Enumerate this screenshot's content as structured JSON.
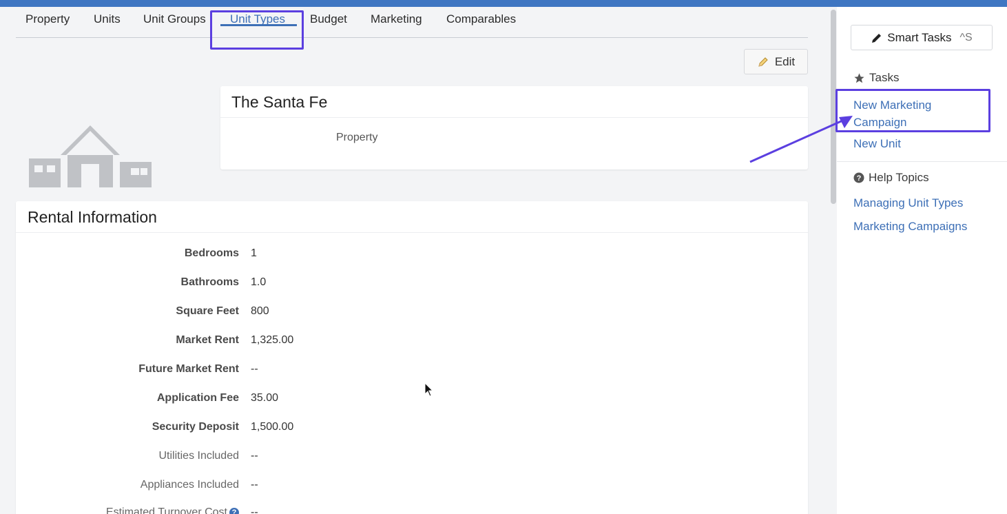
{
  "tabs": [
    {
      "label": "Property"
    },
    {
      "label": "Units"
    },
    {
      "label": "Unit Groups"
    },
    {
      "label": "Unit Types",
      "active": true
    },
    {
      "label": "Budget"
    },
    {
      "label": "Marketing"
    },
    {
      "label": "Comparables"
    }
  ],
  "edit_button": {
    "label": "Edit",
    "icon": "pencil-icon"
  },
  "property_card": {
    "title": "The Santa Fe",
    "property_label": "Property"
  },
  "rental": {
    "title": "Rental Information",
    "rows": [
      {
        "label": "Bedrooms",
        "value": "1"
      },
      {
        "label": "Bathrooms",
        "value": "1.0"
      },
      {
        "label": "Square Feet",
        "value": "800"
      },
      {
        "label": "Market Rent",
        "value": "1,325.00"
      },
      {
        "label": "Future Market Rent",
        "value": "--"
      },
      {
        "label": "Application Fee",
        "value": "35.00"
      },
      {
        "label": "Security Deposit",
        "value": "1,500.00"
      },
      {
        "label": "Utilities Included",
        "value": "--"
      },
      {
        "label": "Appliances Included",
        "value": "--"
      },
      {
        "label": "Estimated Turnover Cost",
        "value": "--"
      }
    ]
  },
  "sidebar": {
    "smart_tasks": {
      "label": "Smart Tasks",
      "shortcut": "^S",
      "icon": "pen-icon"
    },
    "tasks_heading": "Tasks",
    "tasks": [
      {
        "label_line1": "New Marketing",
        "label_line2": "Campaign"
      },
      {
        "label": "New Unit"
      }
    ],
    "help_heading": "Help Topics",
    "help_links": [
      {
        "label": "Managing Unit Types"
      },
      {
        "label": "Marketing Campaigns"
      }
    ]
  },
  "colors": {
    "brand_blue": "#3f76c2",
    "link_blue": "#3d6fb6",
    "annotation_purple": "#5b3fe0"
  }
}
